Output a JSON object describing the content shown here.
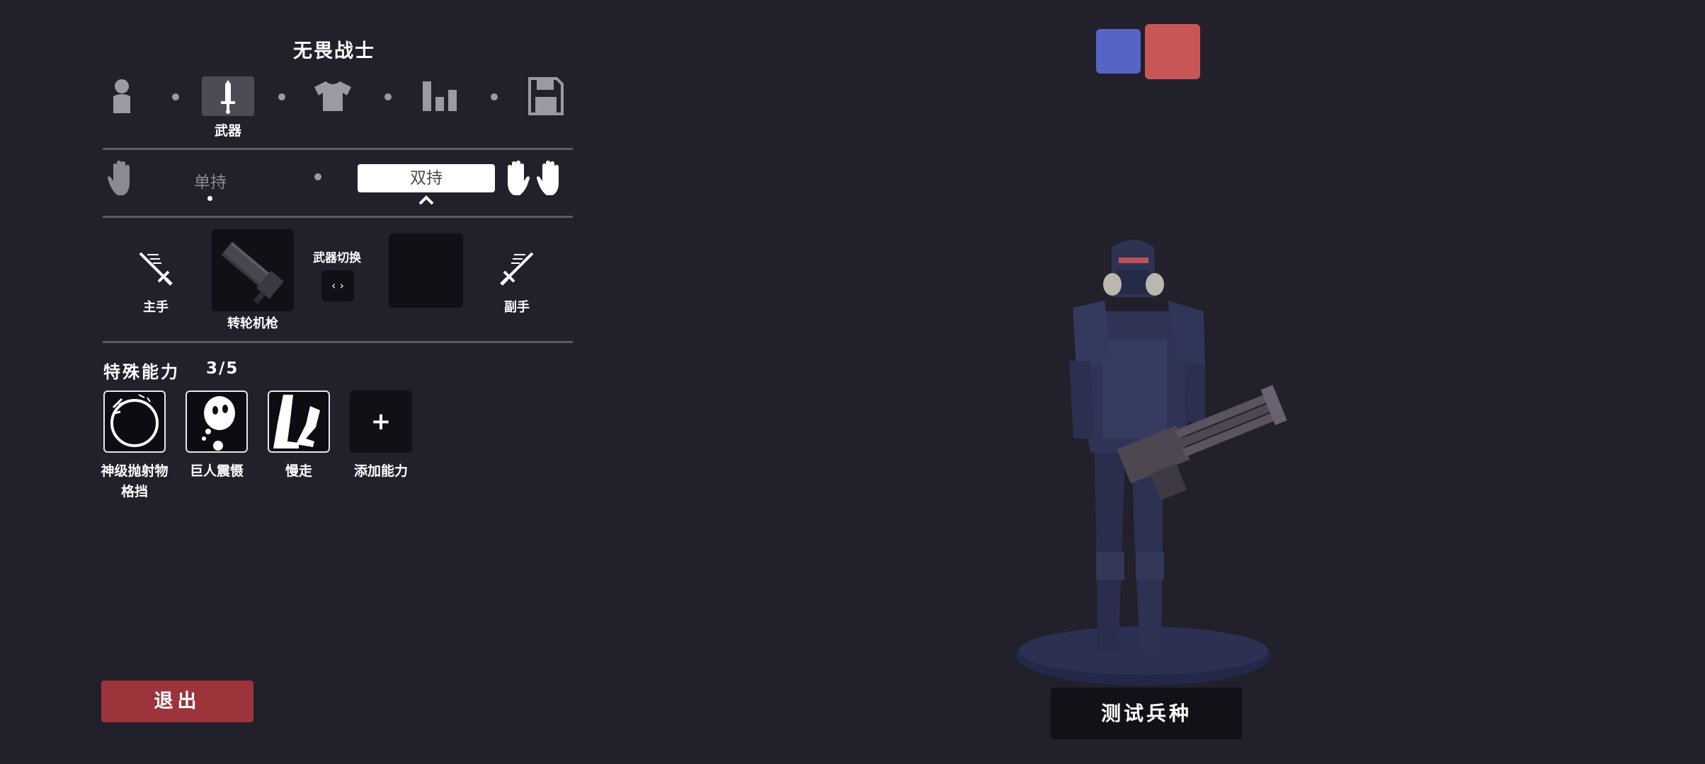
{
  "unit_title": "无畏战士",
  "tabs": [
    {
      "icon": "person-icon",
      "label": ""
    },
    {
      "icon": "sword-icon",
      "label": "武器",
      "active": true
    },
    {
      "icon": "shirt-icon",
      "label": ""
    },
    {
      "icon": "stats-icon",
      "label": ""
    },
    {
      "icon": "save-icon",
      "label": ""
    }
  ],
  "grip": {
    "single_label": "单持",
    "dual_label": "双持",
    "selected": "dual"
  },
  "weapons": {
    "main_hand_label": "主手",
    "off_hand_label": "副手",
    "swap_label": "武器切换",
    "swap_symbol": "‹ ›",
    "main_weapon_name": "转轮机枪"
  },
  "abilities": {
    "heading": "特殊能力",
    "count": "3/5",
    "items": [
      {
        "name": "神级抛射物格挡",
        "line1": "神级抛射物",
        "line2": "格挡",
        "icon": "projectile-block-icon"
      },
      {
        "name": "巨人震慑",
        "icon": "ghost-icon"
      },
      {
        "name": "慢走",
        "icon": "legs-icon"
      },
      {
        "name": "添加能力",
        "symbol": "+",
        "icon": "add-icon"
      }
    ]
  },
  "exit_label": "退出",
  "test_unit_label": "测试兵种",
  "teams": {
    "blue": "#5665c3",
    "red": "#c95656"
  },
  "colors": {
    "background": "#21202b",
    "exit_button": "#9c343c",
    "panel_dark": "#111017"
  }
}
